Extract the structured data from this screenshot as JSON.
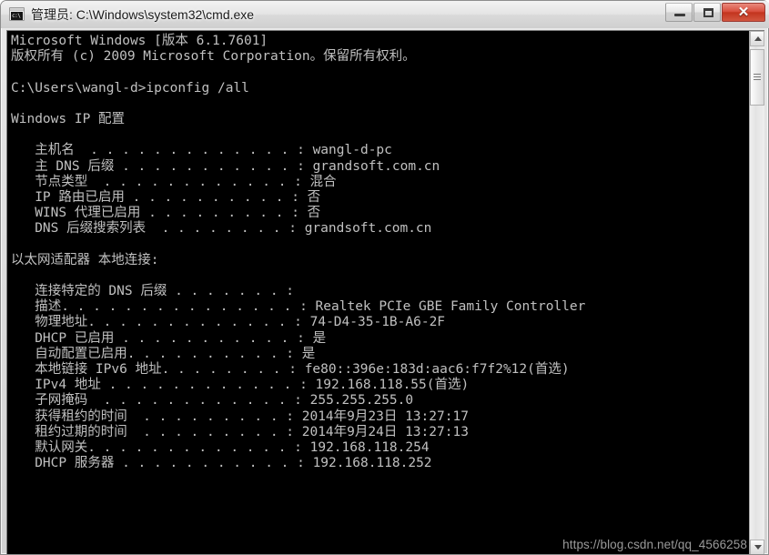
{
  "window": {
    "title": "管理员: C:\\Windows\\system32\\cmd.exe",
    "icon_label": "cmd-icon",
    "icon_text": "c:\\",
    "buttons": {
      "minimize": "—",
      "maximize": "❐",
      "close": "✕"
    }
  },
  "console": {
    "lines": [
      "Microsoft Windows [版本 6.1.7601]",
      "版权所有 (c) 2009 Microsoft Corporation。保留所有权利。",
      "",
      "C:\\Users\\wangl-d>ipconfig /all",
      "",
      "Windows IP 配置",
      "",
      "   主机名  . . . . . . . . . . . . . : wangl-d-pc",
      "   主 DNS 后缀 . . . . . . . . . . . : grandsoft.com.cn",
      "   节点类型  . . . . . . . . . . . . : 混合",
      "   IP 路由已启用 . . . . . . . . . . : 否",
      "   WINS 代理已启用 . . . . . . . . . : 否",
      "   DNS 后缀搜索列表  . . . . . . . . : grandsoft.com.cn",
      "",
      "以太网适配器 本地连接:",
      "",
      "   连接特定的 DNS 后缀 . . . . . . . :",
      "   描述. . . . . . . . . . . . . . . : Realtek PCIe GBE Family Controller",
      "   物理地址. . . . . . . . . . . . . : 74-D4-35-1B-A6-2F",
      "   DHCP 已启用 . . . . . . . . . . . : 是",
      "   自动配置已启用. . . . . . . . . . : 是",
      "   本地链接 IPv6 地址. . . . . . . . : fe80::396e:183d:aac6:f7f2%12(首选)",
      "   IPv4 地址 . . . . . . . . . . . . : 192.168.118.55(首选)",
      "   子网掩码  . . . . . . . . . . . . : 255.255.255.0",
      "   获得租约的时间  . . . . . . . . . : 2014年9月23日 13:27:17",
      "   租约过期的时间  . . . . . . . . . : 2014年9月24日 13:27:13",
      "   默认网关. . . . . . . . . . . . . : 192.168.118.254",
      "   DHCP 服务器 . . . . . . . . . . . : 192.168.118.252"
    ]
  },
  "scrollbar": {
    "up_arrow": "▲",
    "down_arrow": "▼"
  },
  "watermark": {
    "text": "https://blog.csdn.net/qq_4566258"
  },
  "colors": {
    "console_bg": "#000000",
    "console_fg": "#c0c0c0",
    "close_button": "#c3341f",
    "frame": "#dedede"
  }
}
